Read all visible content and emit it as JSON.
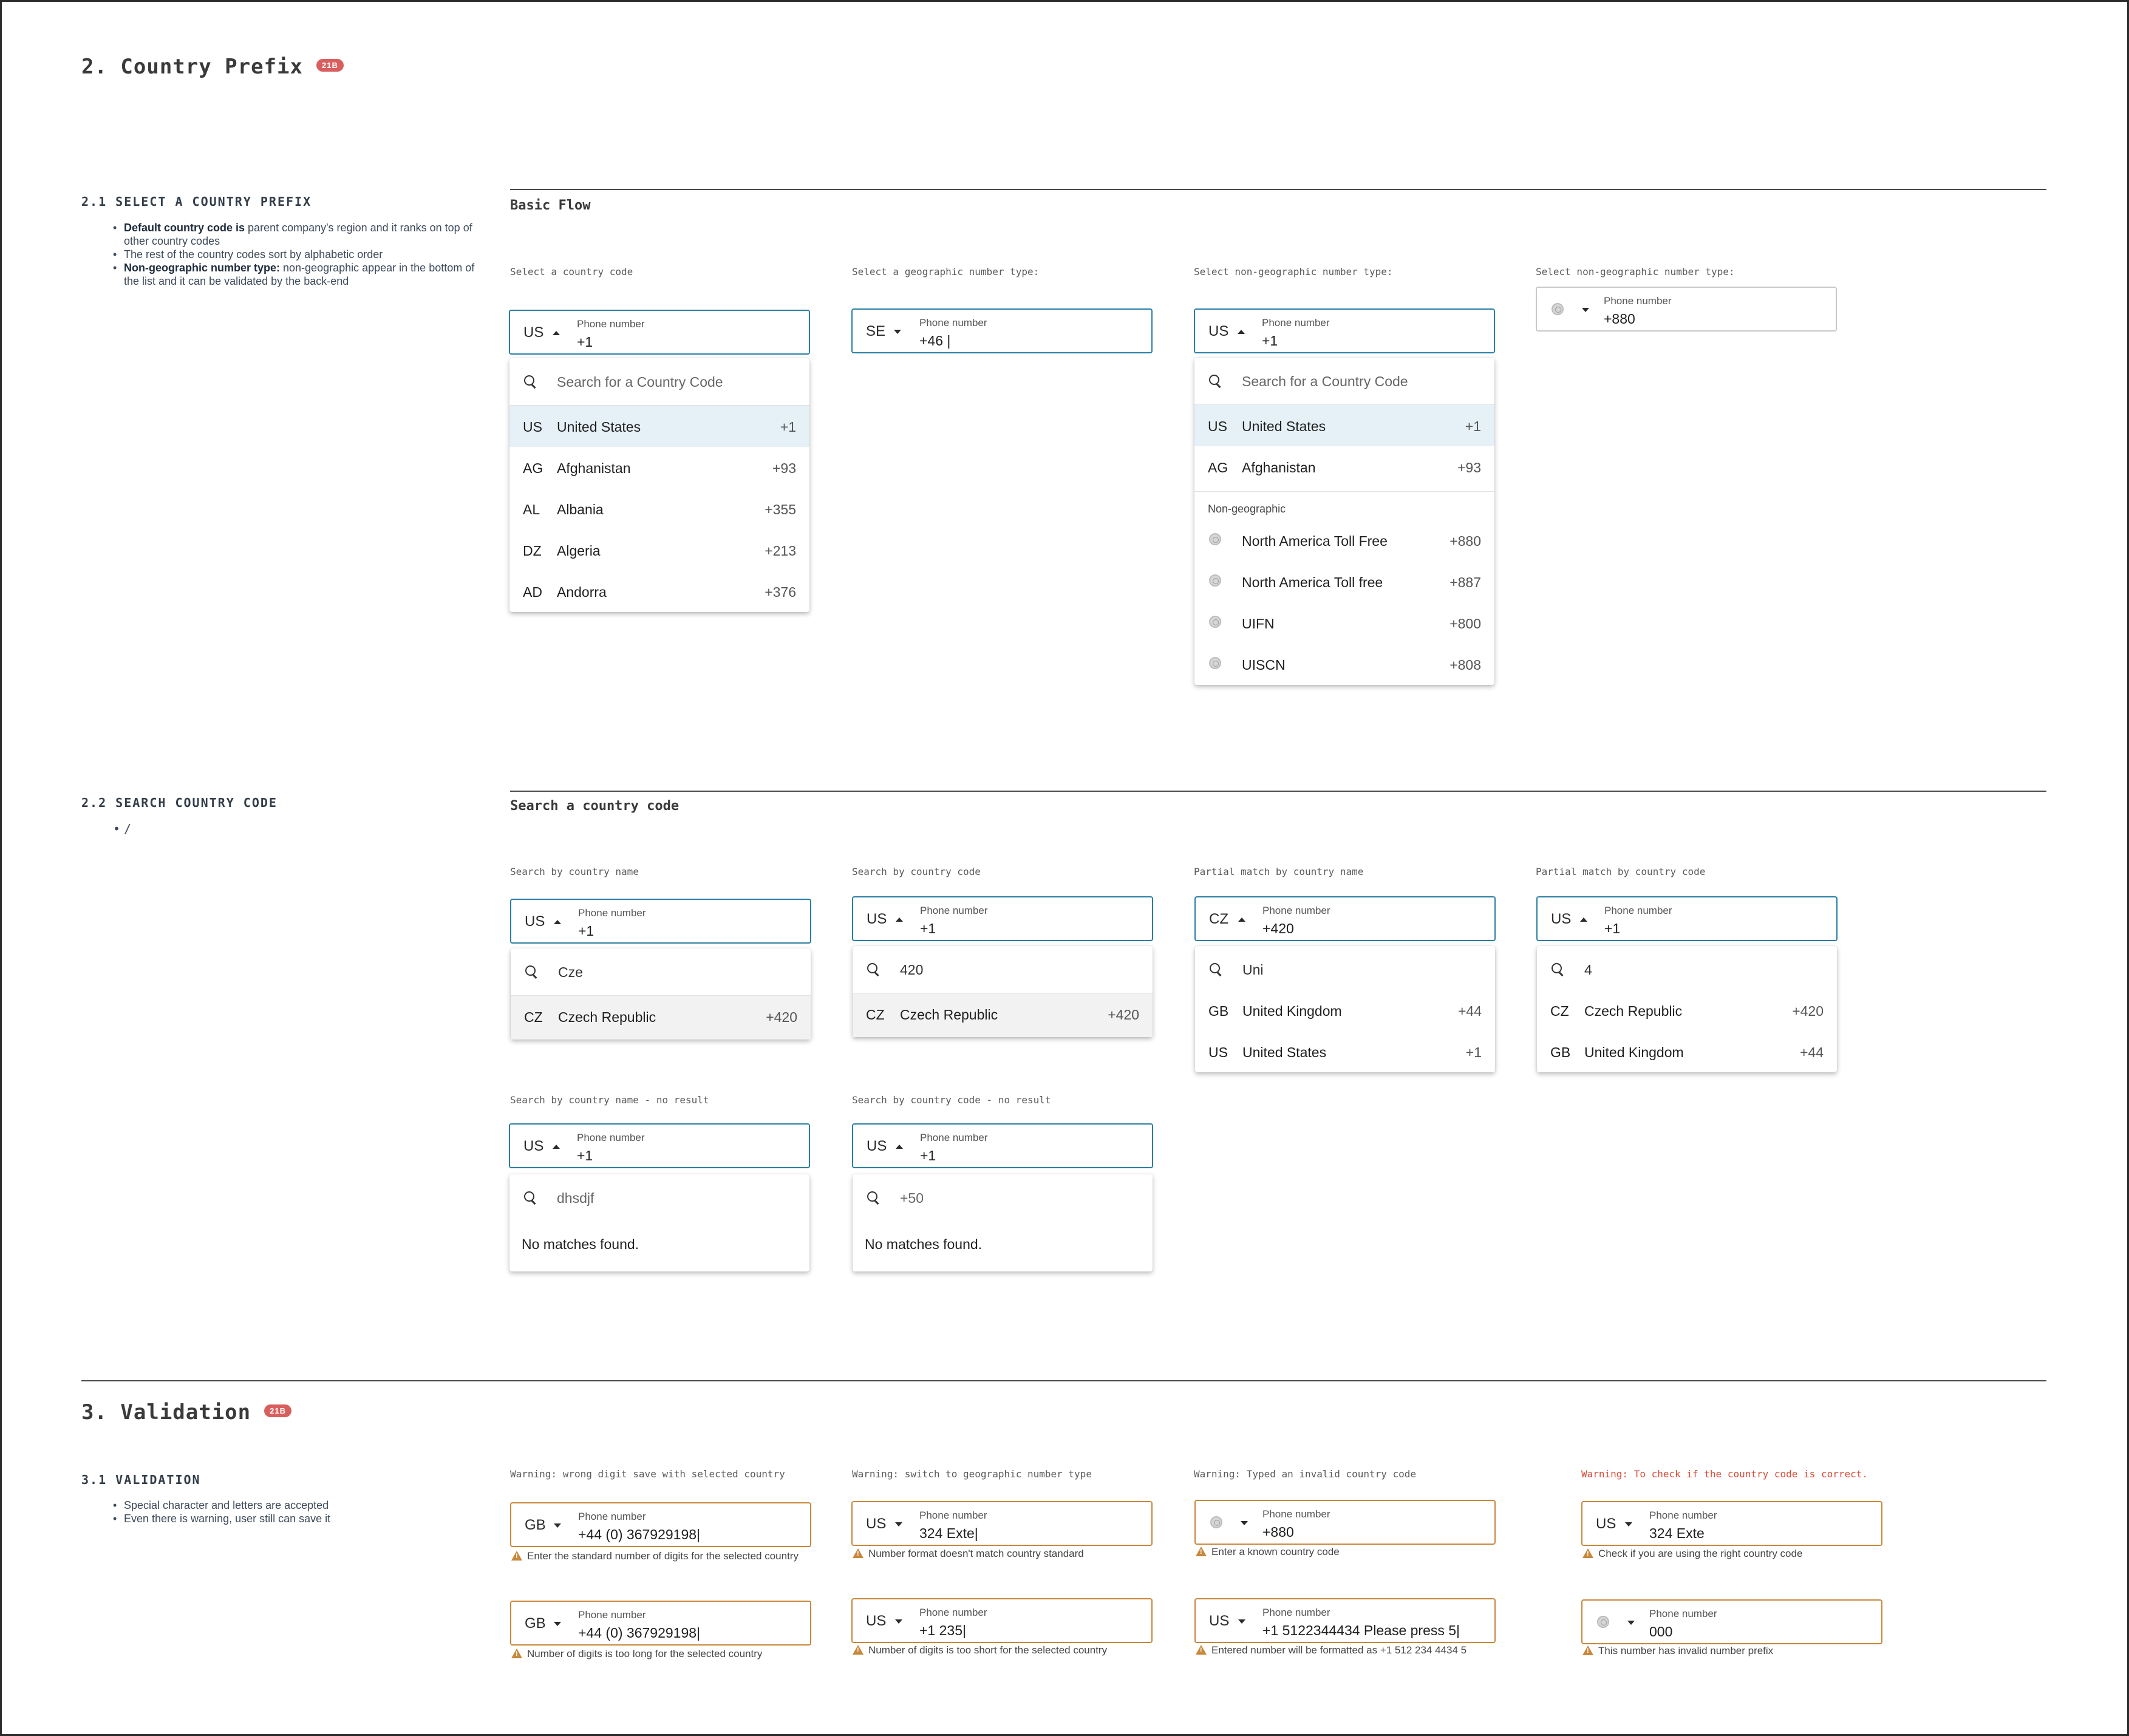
{
  "section2": {
    "title": "2. Country Prefix",
    "badge": "21B",
    "s21": {
      "heading": "2.1 SELECT A COUNTRY PREFIX",
      "note1_bold": "Default country code is",
      "note1_rest": " parent company's region and it ranks on top of other country codes",
      "note2": "The rest of the country codes sort by alphabetic order",
      "note3_bold": "Non-geographic number type:",
      "note3_rest": "  non-geographic appear in the bottom of the list and it can be validated by the back-end"
    },
    "s22": {
      "heading": "2.2 SEARCH COUNTRY CODE",
      "note1": "/"
    }
  },
  "basic_flow": {
    "title": "Basic Flow",
    "captions": [
      "Select a country code",
      "Select a geographic number type:",
      "Select non-geographic number type:",
      "Select non-geographic number type:"
    ]
  },
  "phone_label": "Phone number",
  "search_placeholder": "Search for a Country Code",
  "no_matches": "No matches found.",
  "non_geo_label": "Non-geographic",
  "fields_basic": [
    {
      "code": "US",
      "value": "+1"
    },
    {
      "code": "SE",
      "value": "+46 |"
    },
    {
      "code": "US",
      "value": "+1"
    },
    {
      "code": "",
      "value": "+880"
    }
  ],
  "dd1_rows": [
    {
      "code": "US",
      "name": "United States",
      "prefix": "+1"
    },
    {
      "code": "AG",
      "name": "Afghanistan",
      "prefix": "+93"
    },
    {
      "code": "AL",
      "name": "Albania",
      "prefix": "+355"
    },
    {
      "code": "DZ",
      "name": "Algeria",
      "prefix": "+213"
    },
    {
      "code": "AD",
      "name": "Andorra",
      "prefix": "+376"
    }
  ],
  "dd3_rows": [
    {
      "code": "US",
      "name": "United States",
      "prefix": "+1"
    },
    {
      "code": "AG",
      "name": "Afghanistan",
      "prefix": "+93"
    }
  ],
  "dd3_nongeo": [
    {
      "name": "North America Toll Free",
      "prefix": "+880"
    },
    {
      "name": "North America Toll free",
      "prefix": "+887"
    },
    {
      "name": "UIFN",
      "prefix": "+800"
    },
    {
      "name": "UISCN",
      "prefix": "+808"
    }
  ],
  "search_flow": {
    "title": "Search a country code",
    "captions": [
      "Search by country name",
      "Search by country code",
      "Partial match by country name",
      "Partial match by country code",
      "Search by country name - no result",
      "Search by country code - no result"
    ],
    "fields": [
      {
        "code": "US",
        "value": "+1"
      },
      {
        "code": "US",
        "value": "+1"
      },
      {
        "code": "CZ",
        "value": "+420"
      },
      {
        "code": "US",
        "value": "+1"
      },
      {
        "code": "US",
        "value": "+1"
      },
      {
        "code": "US",
        "value": "+1"
      }
    ],
    "queries": [
      "Cze",
      "420",
      "Uni",
      "4",
      "dhsdjf",
      "+50"
    ],
    "res1": {
      "code": "CZ",
      "name": "Czech Republic",
      "prefix": "+420"
    },
    "res2": {
      "code": "CZ",
      "name": "Czech Republic",
      "prefix": "+420"
    },
    "res3": [
      {
        "code": "GB",
        "name": "United Kingdom",
        "prefix": "+44"
      },
      {
        "code": "US",
        "name": "United States",
        "prefix": "+1"
      }
    ],
    "res4": [
      {
        "code": "CZ",
        "name": "Czech Republic",
        "prefix": "+420"
      },
      {
        "code": "GB",
        "name": "United Kingdom",
        "prefix": "+44"
      }
    ]
  },
  "section3": {
    "title": "3. Validation",
    "badge": "21B",
    "heading": "3.1 VALIDATION",
    "note1": "Special character and letters are accepted",
    "note2": "Even there is warning, user still can save it",
    "captions": [
      "Warning: wrong digit save with selected country",
      "Warning: switch to geographic number type",
      "Warning: Typed an invalid country code",
      "Warning: To check if the country code is correct."
    ],
    "fields": [
      {
        "code": "GB",
        "value": "+44 (0) 367929198|",
        "msg": "Enter the standard number of digits for the selected country"
      },
      {
        "code": "US",
        "value": "324 Exte|",
        "msg": "Number format doesn't match country standard"
      },
      {
        "code": "",
        "value": "+880",
        "msg": "Enter a known country code"
      },
      {
        "code": "US",
        "value": "324 Exte",
        "msg": "Check if you are using the right country code"
      },
      {
        "code": "GB",
        "value": "+44 (0) 367929198|",
        "msg": "Number of digits is too long for the selected country"
      },
      {
        "code": "US",
        "value": "+1 235|",
        "msg": "Number of digits is too short for the selected country"
      },
      {
        "code": "US",
        "value": "+1 5122344434 Please press 5|",
        "msg": "Entered number will be formatted as +1 512 234 4434 5"
      },
      {
        "code": "",
        "value": "000",
        "msg": "This number has invalid number prefix"
      }
    ]
  },
  "colors": {
    "focus_border": "#2a7fa3",
    "warning_border": "#c7883b",
    "selected_row": "#e5f1f6",
    "badge": "#d95f5f",
    "warning_caption": "#d94a38"
  }
}
